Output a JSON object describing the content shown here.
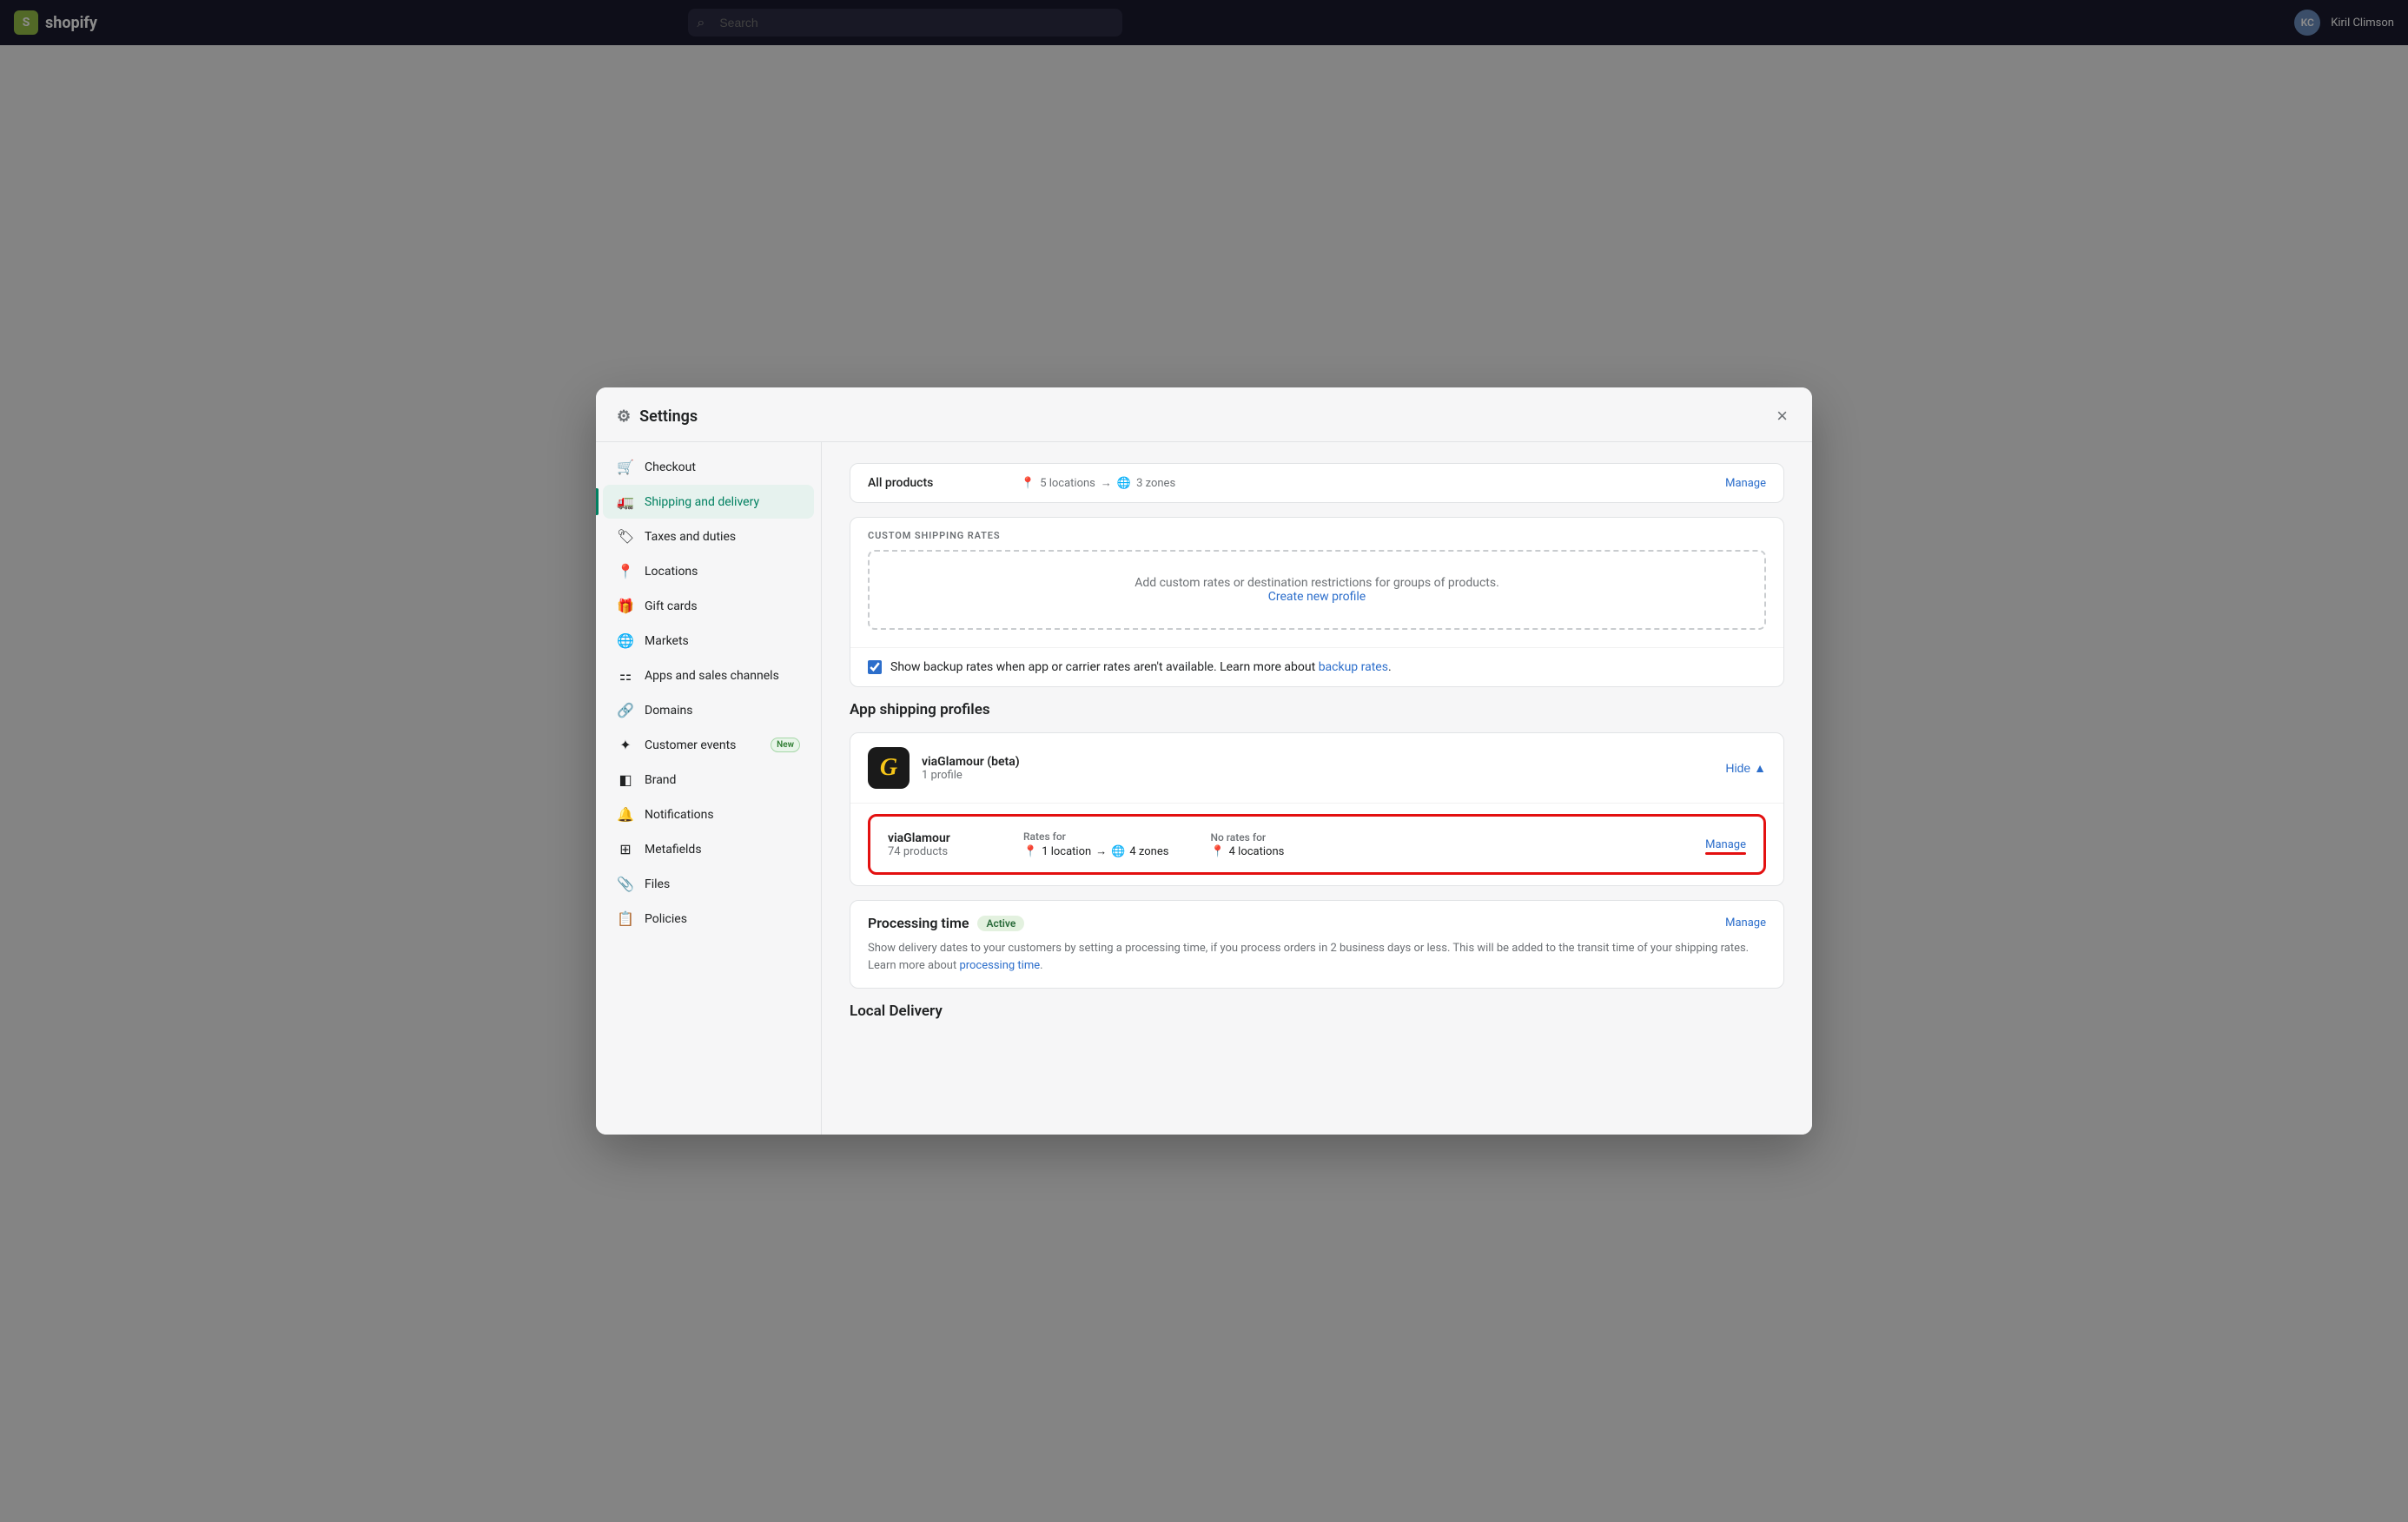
{
  "topbar": {
    "logo_text": "shopify",
    "search_placeholder": "Search",
    "user_name": "Kiril Climson",
    "user_initials": "KC"
  },
  "modal": {
    "title": "Settings",
    "close_label": "×"
  },
  "sidebar": {
    "items": [
      {
        "id": "checkout",
        "label": "Checkout",
        "icon": "🛒"
      },
      {
        "id": "shipping",
        "label": "Shipping and delivery",
        "icon": "🚛",
        "active": true
      },
      {
        "id": "taxes",
        "label": "Taxes and duties",
        "icon": "🏷"
      },
      {
        "id": "locations",
        "label": "Locations",
        "icon": "📍"
      },
      {
        "id": "gift-cards",
        "label": "Gift cards",
        "icon": "🎁"
      },
      {
        "id": "markets",
        "label": "Markets",
        "icon": "🌐"
      },
      {
        "id": "apps",
        "label": "Apps and sales channels",
        "icon": "⚏"
      },
      {
        "id": "domains",
        "label": "Domains",
        "icon": "🔗"
      },
      {
        "id": "customer-events",
        "label": "Customer events",
        "icon": "✦",
        "badge": "New"
      },
      {
        "id": "brand",
        "label": "Brand",
        "icon": "◧"
      },
      {
        "id": "notifications",
        "label": "Notifications",
        "icon": "🔔"
      },
      {
        "id": "metafields",
        "label": "Metafields",
        "icon": "⊞"
      },
      {
        "id": "files",
        "label": "Files",
        "icon": "📎"
      },
      {
        "id": "policies",
        "label": "Policies",
        "icon": "📋"
      }
    ]
  },
  "main": {
    "top_profile": {
      "name": "All products",
      "rates_for_locations": "5 locations",
      "arrow": "→",
      "zones": "3 zones",
      "manage_label": "Manage"
    },
    "custom_shipping": {
      "section_label": "CUSTOM SHIPPING RATES",
      "empty_text": "Add custom rates or destination restrictions for groups of products.",
      "create_link": "Create new profile"
    },
    "backup_rates": {
      "label": "Show backup rates when app or carrier rates aren't available. Learn more about",
      "link_text": "backup rates",
      "link_suffix": ".",
      "checked": true
    },
    "app_profiles": {
      "section_title": "App shipping profiles",
      "app_name": "viaGlamour (beta)",
      "app_profile_count": "1 profile",
      "hide_label": "Hide",
      "via_row": {
        "name": "viaGlamour",
        "products": "74 products",
        "rates_for_label": "Rates for",
        "location_count": "1 location",
        "arrow": "→",
        "zones": "4 zones",
        "no_rates_label": "No rates for",
        "no_locations": "4 locations",
        "manage_label": "Manage"
      }
    },
    "processing_time": {
      "title": "Processing time",
      "badge": "Active",
      "manage_label": "Manage",
      "description": "Show delivery dates to your customers by setting a processing time, if you process orders in 2 business days or less. This will be added to the transit time of your shipping rates. Learn more about",
      "link_text": "processing time",
      "link_suffix": "."
    },
    "local_delivery": {
      "title": "Local Delivery"
    }
  }
}
